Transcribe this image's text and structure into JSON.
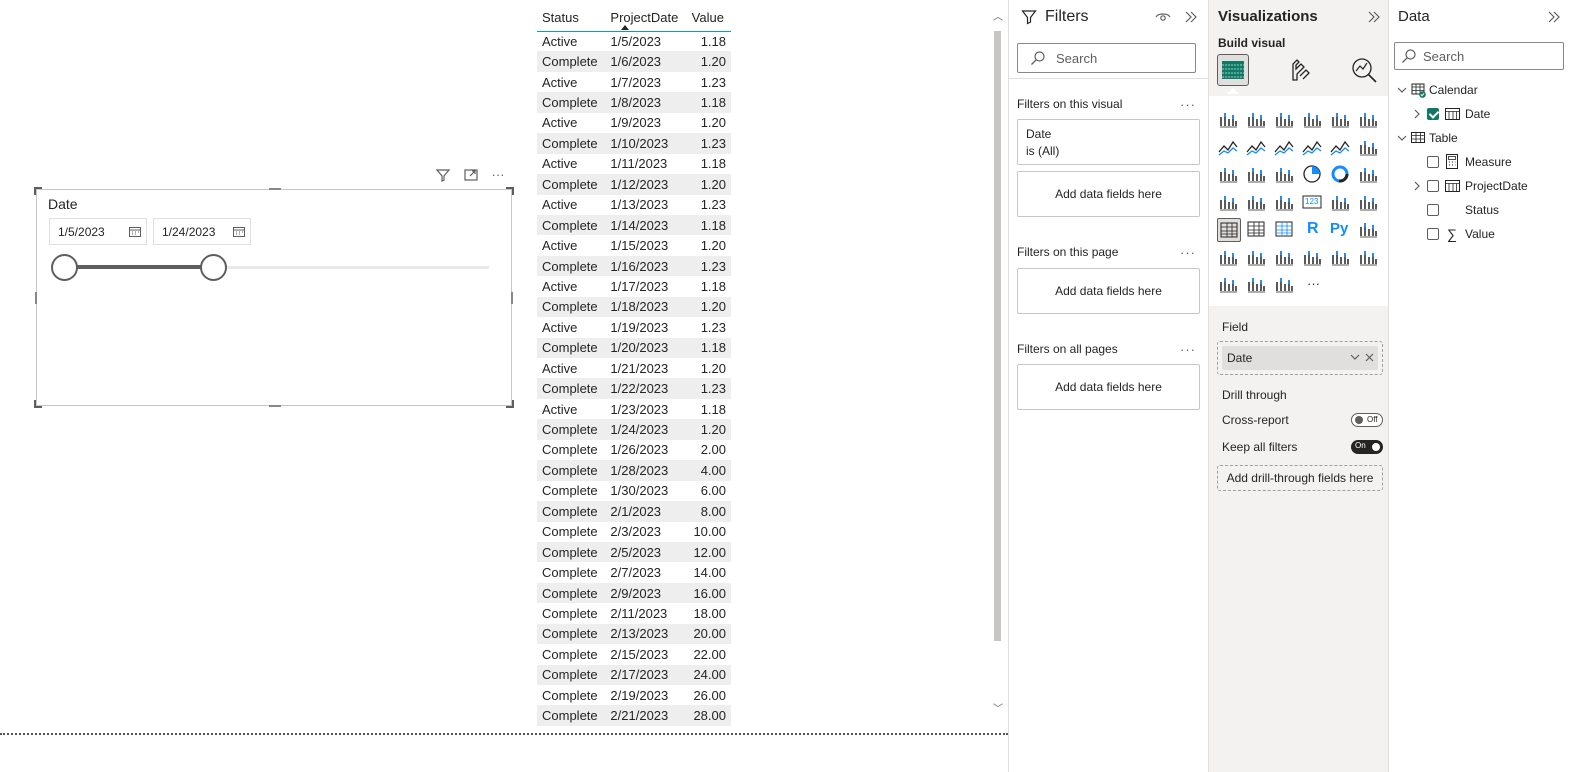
{
  "slicer": {
    "title": "Date",
    "start_date": "1/5/2023",
    "end_date": "1/24/2023",
    "range_fraction": [
      0.0,
      0.35
    ]
  },
  "table": {
    "headers": [
      "Status",
      "ProjectDate",
      "Value"
    ],
    "rows": [
      [
        "Active",
        "1/5/2023",
        "1.18"
      ],
      [
        "Complete",
        "1/6/2023",
        "1.20"
      ],
      [
        "Active",
        "1/7/2023",
        "1.23"
      ],
      [
        "Complete",
        "1/8/2023",
        "1.18"
      ],
      [
        "Active",
        "1/9/2023",
        "1.20"
      ],
      [
        "Complete",
        "1/10/2023",
        "1.23"
      ],
      [
        "Active",
        "1/11/2023",
        "1.18"
      ],
      [
        "Complete",
        "1/12/2023",
        "1.20"
      ],
      [
        "Active",
        "1/13/2023",
        "1.23"
      ],
      [
        "Complete",
        "1/14/2023",
        "1.18"
      ],
      [
        "Active",
        "1/15/2023",
        "1.20"
      ],
      [
        "Complete",
        "1/16/2023",
        "1.23"
      ],
      [
        "Active",
        "1/17/2023",
        "1.18"
      ],
      [
        "Complete",
        "1/18/2023",
        "1.20"
      ],
      [
        "Active",
        "1/19/2023",
        "1.23"
      ],
      [
        "Complete",
        "1/20/2023",
        "1.18"
      ],
      [
        "Active",
        "1/21/2023",
        "1.20"
      ],
      [
        "Complete",
        "1/22/2023",
        "1.23"
      ],
      [
        "Active",
        "1/23/2023",
        "1.18"
      ],
      [
        "Complete",
        "1/24/2023",
        "1.20"
      ],
      [
        "Complete",
        "1/26/2023",
        "2.00"
      ],
      [
        "Complete",
        "1/28/2023",
        "4.00"
      ],
      [
        "Complete",
        "1/30/2023",
        "6.00"
      ],
      [
        "Complete",
        "2/1/2023",
        "8.00"
      ],
      [
        "Complete",
        "2/3/2023",
        "10.00"
      ],
      [
        "Complete",
        "2/5/2023",
        "12.00"
      ],
      [
        "Complete",
        "2/7/2023",
        "14.00"
      ],
      [
        "Complete",
        "2/9/2023",
        "16.00"
      ],
      [
        "Complete",
        "2/11/2023",
        "18.00"
      ],
      [
        "Complete",
        "2/13/2023",
        "20.00"
      ],
      [
        "Complete",
        "2/15/2023",
        "22.00"
      ],
      [
        "Complete",
        "2/17/2023",
        "24.00"
      ],
      [
        "Complete",
        "2/19/2023",
        "26.00"
      ],
      [
        "Complete",
        "2/21/2023",
        "28.00"
      ]
    ]
  },
  "filters": {
    "title": "Filters",
    "search_placeholder": "Search",
    "on_visual_label": "Filters on this visual",
    "filter_card_field": "Date",
    "filter_card_value": "is (All)",
    "add_fields": "Add data fields here",
    "on_page_label": "Filters on this page",
    "on_all_pages_label": "Filters on all pages",
    "more": "···"
  },
  "visualizations": {
    "title": "Visualizations",
    "build_visual": "Build visual",
    "field_label": "Field",
    "field_value": "Date",
    "drill_through_label": "Drill through",
    "cross_report_label": "Cross-report",
    "cross_report_state": "Off",
    "keep_filters_label": "Keep all filters",
    "keep_filters_state": "On",
    "add_drill": "Add drill-through fields here",
    "more": "···",
    "r_label": "R",
    "py_label": "Py",
    "card_label": "123",
    "accent": "#118dff",
    "selected_accent": "#117865"
  },
  "data_pane": {
    "title": "Data",
    "search_placeholder": "Search",
    "calendar": "Calendar",
    "date": "Date",
    "table": "Table",
    "measure": "Measure",
    "projectdate": "ProjectDate",
    "status": "Status",
    "value": "Value",
    "sigma": "∑"
  }
}
